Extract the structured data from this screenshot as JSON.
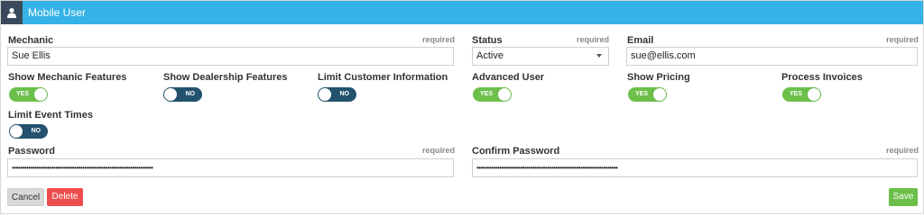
{
  "header": {
    "title": "Mobile User",
    "icon": "user-icon"
  },
  "form": {
    "required_text": "required",
    "mechanic": {
      "label": "Mechanic",
      "value": "Sue Ellis"
    },
    "status": {
      "label": "Status",
      "value": "Active"
    },
    "email": {
      "label": "Email",
      "value": "sue@ellis.com"
    },
    "toggles": {
      "show_mechanic_features": {
        "label": "Show Mechanic Features",
        "state": "YES"
      },
      "show_dealership_features": {
        "label": "Show Dealership Features",
        "state": "NO"
      },
      "limit_customer_information": {
        "label": "Limit Customer Information",
        "state": "NO"
      },
      "advanced_user": {
        "label": "Advanced User",
        "state": "YES"
      },
      "show_pricing": {
        "label": "Show Pricing",
        "state": "YES"
      },
      "process_invoices": {
        "label": "Process Invoices",
        "state": "YES"
      },
      "limit_event_times": {
        "label": "Limit Event Times",
        "state": "NO"
      }
    },
    "password": {
      "label": "Password",
      "value": "••••••••••••••••••••••••••••••••••••••••••••••••••••••••••••••••••••"
    },
    "confirm_password": {
      "label": "Confirm Password",
      "value": "••••••••••••••••••••••••••••••••••••••••••••••••••••••••••••••••••••"
    }
  },
  "buttons": {
    "cancel": "Cancel",
    "delete": "Delete",
    "save": "Save"
  },
  "colors": {
    "header": "#35b3e6",
    "toggle_on": "#6cc04a",
    "toggle_off": "#23526e",
    "delete": "#ee4d4d",
    "save": "#6cc04a"
  }
}
